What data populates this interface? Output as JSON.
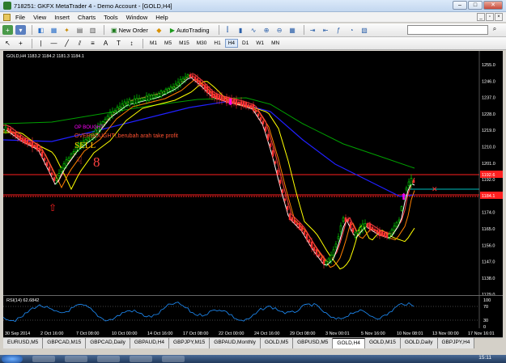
{
  "window": {
    "title": "718251: GKFX MetaTrader 4 - Demo Account - [GOLD,H4]",
    "buttons": {
      "minimize": "–",
      "maximize": "□",
      "close": "✕"
    }
  },
  "menu": [
    "File",
    "View",
    "Insert",
    "Charts",
    "Tools",
    "Window",
    "Help"
  ],
  "toolbar": {
    "new_order": "New Order",
    "autotrading": "AutoTrading",
    "search_placeholder": ""
  },
  "timeframes": [
    "M1",
    "M5",
    "M15",
    "M30",
    "H1",
    "H4",
    "D1",
    "W1",
    "MN"
  ],
  "active_timeframe": "H4",
  "chart": {
    "header": "GOLD,H4  1183.2 1184.2 1181.3 1184.1",
    "annotation_ob": "OP BOUGHT",
    "annotation_text": "OVERBOUGHT!,berubah arah take profit",
    "signal": "SELL",
    "signal_digit": "8",
    "price_labels": [
      "1255.0",
      "1246.0",
      "1237.0",
      "1228.0",
      "1219.0",
      "1210.0",
      "1201.0",
      "1192.0",
      "1183.0",
      "1174.0",
      "1165.0",
      "1156.0",
      "1147.0",
      "1138.0",
      "1129.0"
    ],
    "current_price": "1184.1",
    "resistance_price": "1192.6",
    "colors": {
      "bg": "#000000",
      "bull": "#00ff00",
      "bear": "#ff3333",
      "ma_fast": "#ffffff",
      "ma_mid": "#ff4040",
      "ma_yellow": "#ffff00",
      "ma_blue": "#2020ff",
      "ma_green": "#00a000",
      "arrow": "#ff00ff"
    }
  },
  "indicator": {
    "label": "RSI(14) 62.6842",
    "levels": [
      "70",
      "30"
    ],
    "scale_top": "100",
    "scale_bottom": "0"
  },
  "time_axis": [
    "30 Sep 2014",
    "2 Oct 16:00",
    "7 Oct 08:00",
    "10 Oct 00:00",
    "14 Oct 16:00",
    "17 Oct 08:00",
    "22 Oct 00:00",
    "24 Oct 16:00",
    "29 Oct 08:00",
    "3 Nov 00:01",
    "5 Nov 16:00",
    "10 Nov 08:01",
    "13 Nov 00:00",
    "17 Nov 16:01"
  ],
  "tabs": [
    "EURUSD,M5",
    "GBPCAD,M15",
    "GBPCAD,Daily",
    "GBPAUD,H4",
    "GBPJPY,M15",
    "GBPAUD,Monthly",
    "GOLD,M5",
    "GBPUSD,M5",
    "GOLD,H4",
    "GOLD,M15",
    "GOLD,Daily",
    "GBPJPY,H4"
  ],
  "active_tab": "GOLD,H4",
  "taskbar": {
    "clock": "15:11"
  }
}
